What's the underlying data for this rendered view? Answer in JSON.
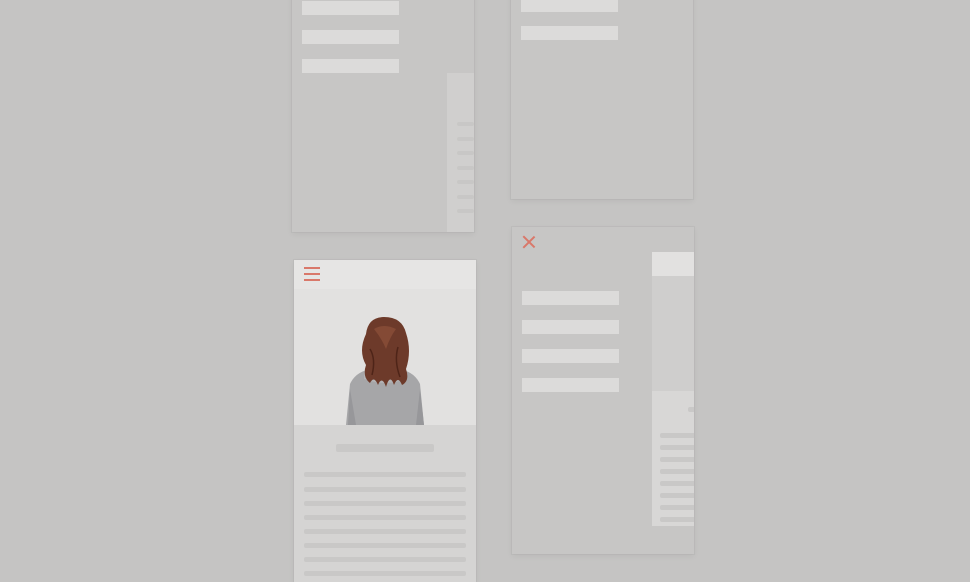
{
  "colors": {
    "background": "#c5c4c3",
    "accent": "#d9786a",
    "placeholder_bar": "#dcdbda",
    "header": "#e6e5e4"
  },
  "screens": {
    "menu_open_top_left": {
      "menu_items": 3
    },
    "menu_open_top_right": {
      "menu_items": 2
    },
    "article_screen": {
      "menu_icon": "hamburger-icon",
      "hero_image": "woman-with-hair-over-face-photo"
    },
    "menu_open_bottom_right": {
      "close_icon": "close-icon",
      "menu_items": 4
    }
  }
}
